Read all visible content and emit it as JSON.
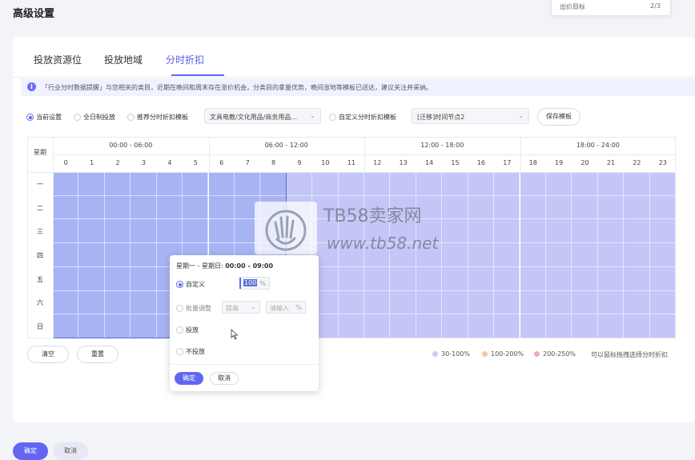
{
  "page": {
    "title": "高级设置"
  },
  "top_right": {
    "label": "出价目标",
    "count": "2/3"
  },
  "tabs": [
    {
      "label": "投放资源位",
      "active": false
    },
    {
      "label": "投放地域",
      "active": false
    },
    {
      "label": "分时折扣",
      "active": true
    }
  ],
  "notice": {
    "text": "「行业分时数据提醒」与您相关的类目，近期在晚间和周末存在涨价机会，分类目的拿量优势，晚间涨地等模板已送达，建议关注并采纳。"
  },
  "options": {
    "current": "当前设置",
    "all_day": "全日制投放",
    "recommended": "推荐分时折扣模板",
    "category_select": "文具电教/文化用品/商务用品...",
    "custom": "自定义分时折扣模板",
    "template_select": "[迁移]时间节点2",
    "save_template": "保存模板"
  },
  "grid": {
    "week_label": "星期",
    "ranges": [
      "00:00 - 06:00",
      "06:00 - 12:00",
      "12:00 - 18:00",
      "18:00 - 24:00"
    ],
    "hours": [
      "0",
      "1",
      "2",
      "3",
      "4",
      "5",
      "6",
      "7",
      "8",
      "9",
      "10",
      "11",
      "12",
      "13",
      "14",
      "15",
      "16",
      "17",
      "18",
      "19",
      "20",
      "21",
      "22",
      "23"
    ],
    "days": [
      "一",
      "二",
      "三",
      "四",
      "五",
      "六",
      "日"
    ]
  },
  "actions": {
    "clear": "清空",
    "reset": "重置"
  },
  "legend": {
    "items": [
      {
        "label": "30-100%",
        "color": "#c9cbf5"
      },
      {
        "label": "100-200%",
        "color": "#f9c69b"
      },
      {
        "label": "200-250%",
        "color": "#f0a5c8"
      }
    ],
    "hint": "可以鼠标拖拽选择分时折扣"
  },
  "popup": {
    "range_prefix": "星期一 - 星期日:",
    "range_time": "00:00 - 09:00",
    "custom_label": "自定义",
    "custom_value": "100",
    "percent": "%",
    "bulk_label": "批量调整",
    "bulk_select": "提高",
    "bulk_placeholder": "请输入",
    "on_label": "投放",
    "off_label": "不投放",
    "confirm": "确定",
    "cancel": "取消"
  },
  "watermark": {
    "title": "TB58卖家网",
    "url": "www.tb58.net"
  },
  "footer": {
    "confirm": "确定",
    "cancel": "取消"
  },
  "colors": {
    "accent": "#6366f1",
    "selected_cell": "#a7b4f4",
    "cell": "#c3c6f6",
    "cell_hover_border": "#5a66d8"
  }
}
